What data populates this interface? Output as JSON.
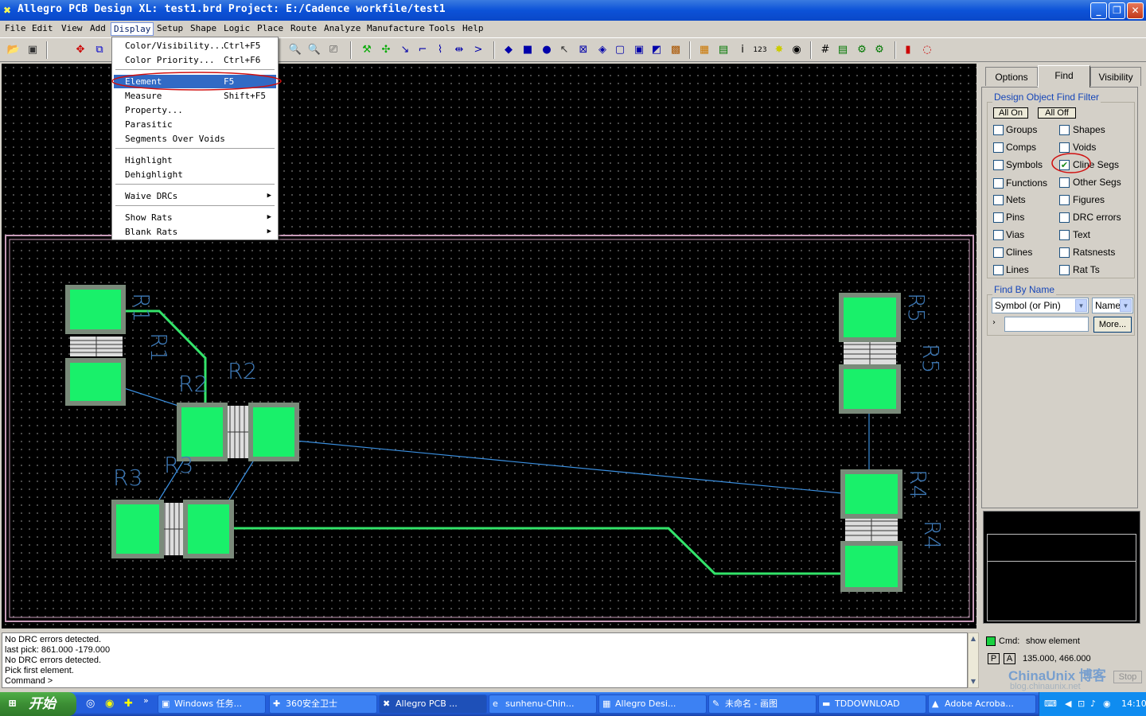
{
  "window": {
    "title": "Allegro PCB Design XL: test1.brd  Project: E:/Cadence workfile/test1",
    "minimize": "_",
    "maximize": "❐",
    "close": "✕"
  },
  "menubar": {
    "items": [
      "File",
      "Edit",
      "View",
      "Add",
      "Display",
      "Setup",
      "Shape",
      "Logic",
      "Place",
      "Route",
      "Analyze",
      "Manufacture",
      "Tools",
      "Help"
    ],
    "active": "Display"
  },
  "display_menu": {
    "items": [
      {
        "label": "Color/Visibility...",
        "shortcut": "Ctrl+F5"
      },
      {
        "label": "Color Priority...",
        "shortcut": "Ctrl+F6"
      },
      {
        "label": "Element",
        "shortcut": "F5",
        "selected": true
      },
      {
        "label": "Measure",
        "shortcut": "Shift+F5"
      },
      {
        "label": "Property...",
        "shortcut": ""
      },
      {
        "label": "Parasitic",
        "shortcut": ""
      },
      {
        "label": "Segments Over Voids",
        "shortcut": ""
      },
      {
        "label": "Highlight",
        "shortcut": ""
      },
      {
        "label": "Dehighlight",
        "shortcut": ""
      },
      {
        "label": "Waive DRCs",
        "shortcut": "",
        "submenu": true
      },
      {
        "label": "Show Rats",
        "shortcut": "",
        "submenu": true
      },
      {
        "label": "Blank Rats",
        "shortcut": "",
        "submenu": true
      }
    ]
  },
  "board": {
    "refdes": [
      "R1",
      "R1",
      "R2",
      "R2",
      "R3",
      "R3",
      "R5",
      "R5",
      "R4",
      "R4"
    ],
    "pad_color": "#19f06a",
    "pad_border": "#7a8a7a",
    "trace_color": "#33e36a",
    "rat_color": "#3a8fe0",
    "outline_color": "#c79ab8",
    "label_color": "#3e7ab8"
  },
  "right_panel": {
    "tabs": [
      "Options",
      "Find",
      "Visibility"
    ],
    "active_tab": "Find",
    "filter_title": "Design Object Find Filter",
    "all_on": "All On",
    "all_off": "All Off",
    "left_column": [
      {
        "label": "Groups",
        "checked": false
      },
      {
        "label": "Comps",
        "checked": false
      },
      {
        "label": "Symbols",
        "checked": false
      },
      {
        "label": "Functions",
        "checked": false
      },
      {
        "label": "Nets",
        "checked": false
      },
      {
        "label": "Pins",
        "checked": false
      },
      {
        "label": "Vias",
        "checked": false
      },
      {
        "label": "Clines",
        "checked": false
      },
      {
        "label": "Lines",
        "checked": false
      }
    ],
    "right_column": [
      {
        "label": "Shapes",
        "checked": false
      },
      {
        "label": "Voids",
        "checked": false
      },
      {
        "label": "Cline Segs",
        "checked": true
      },
      {
        "label": "Other Segs",
        "checked": false
      },
      {
        "label": "Figures",
        "checked": false
      },
      {
        "label": "DRC errors",
        "checked": false
      },
      {
        "label": "Text",
        "checked": false
      },
      {
        "label": "Ratsnests",
        "checked": false
      },
      {
        "label": "Rat Ts",
        "checked": false
      }
    ],
    "find_by_name": "Find By Name",
    "type_select": "Symbol (or Pin)",
    "name_select": "Name",
    "name_input": "",
    "more_button": "More..."
  },
  "console": {
    "lines": [
      "No DRC errors detected.",
      "last pick:  861.000 -179.000",
      "No DRC errors detected.",
      "Pick first element.",
      "Command >"
    ]
  },
  "status": {
    "cmd_label": "Cmd:",
    "cmd_value": "show element",
    "p": "P",
    "a": "A",
    "coords": "135.000, 466.000",
    "stop": "Stop",
    "watermark": "ChinaUnix 博客",
    "watermark_url": "blog.chinaunix.net"
  },
  "taskbar": {
    "start": "开始",
    "tasks": [
      {
        "label": "Windows 任务...",
        "icon": "▣"
      },
      {
        "label": "360安全卫士",
        "icon": "✚"
      },
      {
        "label": "Allegro PCB ...",
        "icon": "✖",
        "active": true
      },
      {
        "label": "sunhenu-Chin...",
        "icon": "e"
      },
      {
        "label": "Allegro Desi...",
        "icon": "▦"
      },
      {
        "label": "未命名 - 画图",
        "icon": "✎"
      },
      {
        "label": "TDDOWNLOAD",
        "icon": "▬"
      },
      {
        "label": "Adobe Acroba...",
        "icon": "▲"
      }
    ],
    "clock": "14:10"
  }
}
